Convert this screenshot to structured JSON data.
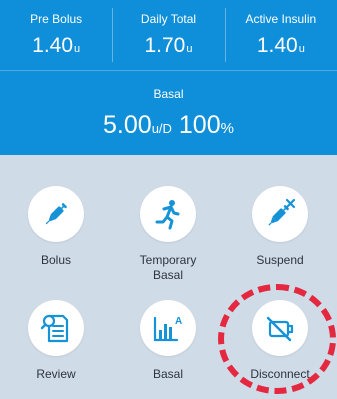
{
  "header": {
    "stats": [
      {
        "label": "Pre Bolus",
        "value": "1.40",
        "unit": "u"
      },
      {
        "label": "Daily Total",
        "value": "1.70",
        "unit": "u"
      },
      {
        "label": "Active Insulin",
        "value": "1.40",
        "unit": "u"
      }
    ]
  },
  "basal": {
    "label": "Basal",
    "rate": "5.00",
    "rate_unit": "u/D",
    "percent": "100",
    "percent_unit": "%"
  },
  "actions": [
    {
      "label": "Bolus",
      "icon": "syringe-icon"
    },
    {
      "label": "Temporary",
      "label2": "Basal",
      "icon": "running-person-icon"
    },
    {
      "label": "Suspend",
      "icon": "syringe-x-icon"
    },
    {
      "label": "Review",
      "icon": "document-search-icon"
    },
    {
      "label": "Basal",
      "icon": "bar-chart-icon"
    },
    {
      "label": "Disconnect",
      "icon": "disconnect-device-icon"
    }
  ],
  "colors": {
    "primary": "#0f8fd9",
    "background": "#cfdbe7",
    "highlight": "#e4283f",
    "icon": "#1593d6"
  }
}
